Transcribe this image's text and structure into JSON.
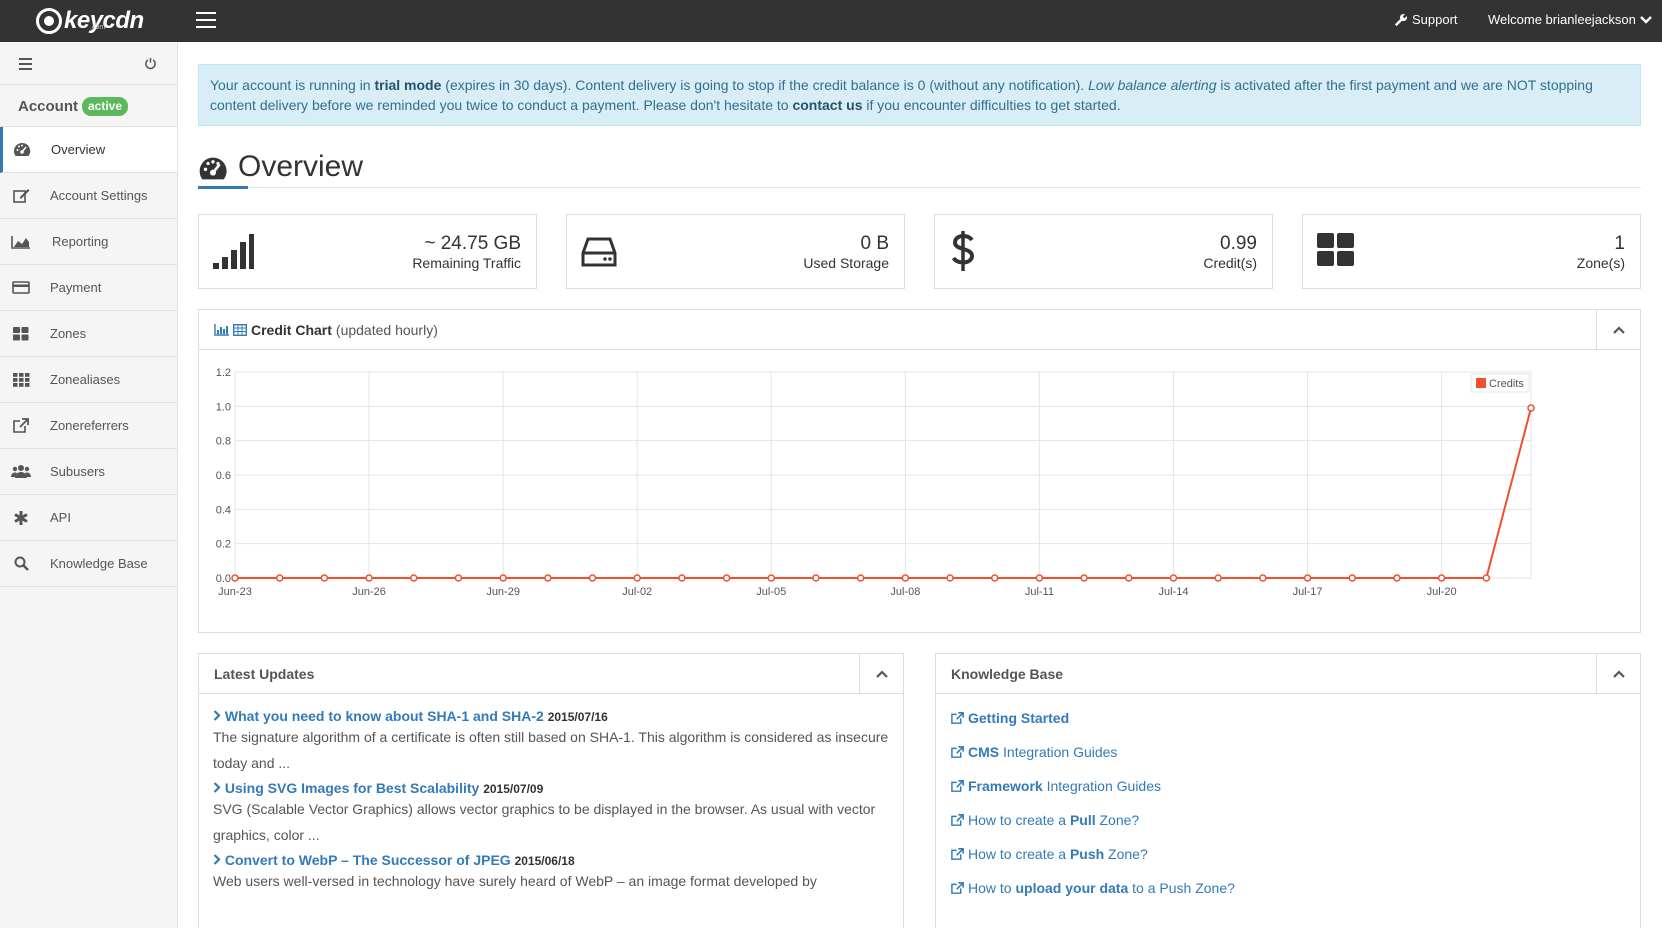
{
  "topbar": {
    "logo_text": "keycdn",
    "logo_sub": ".com",
    "support_label": "Support",
    "welcome_label": "Welcome brianleejackson"
  },
  "sidebar": {
    "account_label": "Account",
    "account_status": "active",
    "items": [
      {
        "label": "Overview",
        "icon": "dashboard-icon"
      },
      {
        "label": "Account Settings",
        "icon": "edit-icon"
      },
      {
        "label": "Reporting",
        "icon": "area-chart-icon"
      },
      {
        "label": "Payment",
        "icon": "credit-card-icon"
      },
      {
        "label": "Zones",
        "icon": "grid-icon"
      },
      {
        "label": "Zonealiases",
        "icon": "grid-small-icon"
      },
      {
        "label": "Zonereferrers",
        "icon": "external-link-icon"
      },
      {
        "label": "Subusers",
        "icon": "users-icon"
      },
      {
        "label": "API",
        "icon": "asterisk-icon"
      },
      {
        "label": "Knowledge Base",
        "icon": "search-icon"
      }
    ]
  },
  "alert": {
    "t1": "Your account is running in ",
    "b1": "trial mode",
    "t2": " (expires in 30 days). Content delivery is going to stop if the credit balance is 0 (without any notification). ",
    "i1": "Low balance alerting",
    "t3": " is activated after the first payment and we are NOT stopping content delivery before we reminded you twice to conduct a payment. Please don't hesitate to ",
    "link": "contact us",
    "t4": " if you encounter difficulties to get started."
  },
  "page": {
    "title": "Overview"
  },
  "stats": [
    {
      "value": "~ 24.75 GB",
      "label": "Remaining Traffic",
      "icon": "signal-icon"
    },
    {
      "value": "0 B",
      "label": "Used Storage",
      "icon": "hdd-icon"
    },
    {
      "value": "0.99",
      "label": "Credit(s)",
      "icon": "dollar-icon"
    },
    {
      "value": "1",
      "label": "Zone(s)",
      "icon": "grid-icon"
    }
  ],
  "credit_panel": {
    "title_bold": "Credit Chart",
    "title_rest": "(updated hourly)"
  },
  "chart_data": {
    "type": "line",
    "legend": "top-right",
    "grid": true,
    "ylim": [
      0,
      1.2
    ],
    "yticks": [
      "0.0",
      "0.2",
      "0.4",
      "0.6",
      "0.8",
      "1.0",
      "1.2"
    ],
    "xticks": [
      "Jun-23",
      "Jun-26",
      "Jun-29",
      "Jul-02",
      "Jul-05",
      "Jul-08",
      "Jul-11",
      "Jul-14",
      "Jul-17",
      "Jul-20"
    ],
    "series": [
      {
        "name": "Credits",
        "color": "#f0502d",
        "x": [
          "Jun-23",
          "Jun-24",
          "Jun-25",
          "Jun-26",
          "Jun-27",
          "Jun-28",
          "Jun-29",
          "Jun-30",
          "Jul-01",
          "Jul-02",
          "Jul-03",
          "Jul-04",
          "Jul-05",
          "Jul-06",
          "Jul-07",
          "Jul-08",
          "Jul-09",
          "Jul-10",
          "Jul-11",
          "Jul-12",
          "Jul-13",
          "Jul-14",
          "Jul-15",
          "Jul-16",
          "Jul-17",
          "Jul-18",
          "Jul-19",
          "Jul-20",
          "Jul-21",
          "Jul-22"
        ],
        "values": [
          0,
          0,
          0,
          0,
          0,
          0,
          0,
          0,
          0,
          0,
          0,
          0,
          0,
          0,
          0,
          0,
          0,
          0,
          0,
          0,
          0,
          0,
          0,
          0,
          0,
          0,
          0,
          0,
          0,
          0.99
        ]
      }
    ]
  },
  "updates_panel": {
    "title": "Latest Updates",
    "items": [
      {
        "title": "What you need to know about SHA-1 and SHA-2",
        "date": "2015/07/16",
        "text": "The signature algorithm of a certificate is often still based on SHA-1. This algorithm is considered as insecure today and ..."
      },
      {
        "title": "Using SVG Images for Best Scalability",
        "date": "2015/07/09",
        "text": "SVG (Scalable Vector Graphics) allows vector graphics to be displayed in the browser. As usual with vector graphics, color ..."
      },
      {
        "title": "Convert to WebP – The Successor of JPEG",
        "date": "2015/06/18",
        "text": "Web users well-versed in technology have surely heard of WebP – an image format developed by"
      }
    ]
  },
  "kb_panel": {
    "title": "Knowledge Base",
    "links": [
      {
        "pre": "",
        "bold": "Getting Started",
        "post": ""
      },
      {
        "pre": "",
        "bold": "CMS",
        "post": " Integration Guides"
      },
      {
        "pre": "",
        "bold": "Framework",
        "post": " Integration Guides"
      },
      {
        "pre": "How to create a ",
        "bold": "Pull",
        "post": " Zone?"
      },
      {
        "pre": "How to create a ",
        "bold": "Push",
        "post": " Zone?"
      },
      {
        "pre": "How to ",
        "bold": "upload your data",
        "post": " to a Push Zone?"
      }
    ]
  }
}
